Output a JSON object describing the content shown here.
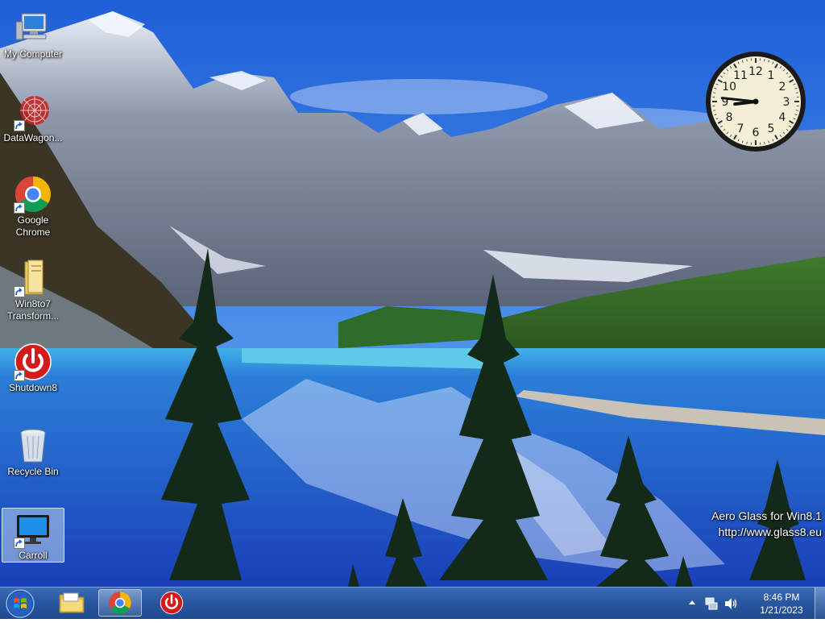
{
  "desktop": {
    "icons": [
      {
        "label": "My Computer",
        "icon": "computer-icon"
      },
      {
        "label": "DataWagon...",
        "icon": "datawagon-icon"
      },
      {
        "label": "Google\nChrome",
        "icon": "chrome-icon"
      },
      {
        "label": "Win8to7\nTransform...",
        "icon": "folder-icon"
      },
      {
        "label": "Shutdown8",
        "icon": "power-icon"
      },
      {
        "label": "Recycle Bin",
        "icon": "recycle-bin-icon"
      },
      {
        "label": "Carroll",
        "icon": "monitor-icon",
        "selected": true
      }
    ]
  },
  "clock_gadget": {
    "numerals": [
      "12",
      "1",
      "2",
      "3",
      "4",
      "5",
      "6",
      "7",
      "8",
      "9",
      "10",
      "11"
    ],
    "time": {
      "hour": 8,
      "minute": 46
    }
  },
  "watermark": {
    "line1": "Aero Glass for Win8.1",
    "line2": "http://www.glass8.eu"
  },
  "taskbar": {
    "pinned": [
      {
        "name": "file-explorer",
        "icon": "folder-icon",
        "active": false
      },
      {
        "name": "google-chrome",
        "icon": "chrome-icon",
        "active": true
      },
      {
        "name": "shutdown8",
        "icon": "power-icon",
        "active": false
      }
    ],
    "tray": {
      "icons": [
        "show-hidden-icons-arrow",
        "network-icon",
        "volume-icon"
      ],
      "time": "8:46 PM",
      "date": "1/21/2023"
    }
  },
  "colors": {
    "taskbar": "#2a57a1",
    "sky": "#3f7fe0",
    "lake": "#1d4fc9",
    "forest": "#2c5a22"
  }
}
